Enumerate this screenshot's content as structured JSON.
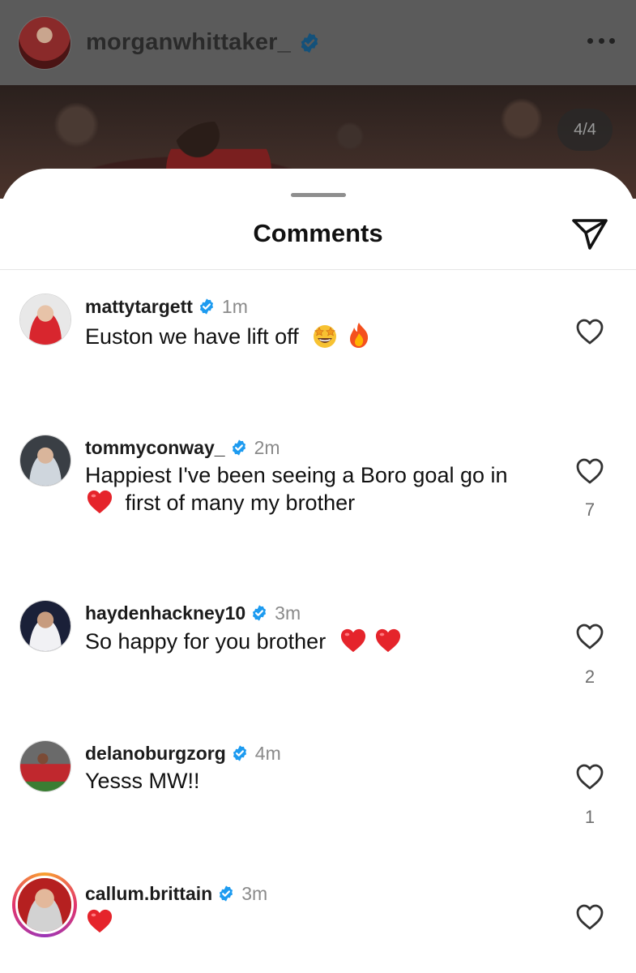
{
  "post": {
    "username": "morganwhittaker_",
    "counter": "4/4"
  },
  "sheet": {
    "title": "Comments"
  },
  "comments": [
    {
      "username": "mattytargett",
      "time": "1m",
      "text": "Euston we have lift off",
      "text_emojis": [
        "star-struck",
        "fire"
      ],
      "likes": ""
    },
    {
      "username": "tommyconway_",
      "time": "2m",
      "text_line1": "Happiest I've been seeing a Boro goal go in",
      "text_line2": "first of many my brother",
      "text_emojis": [
        "red-heart"
      ],
      "likes": "7"
    },
    {
      "username": "haydenhackney10",
      "time": "3m",
      "text": "So happy for you brother",
      "text_emojis": [
        "red-heart",
        "red-heart"
      ],
      "likes": "2"
    },
    {
      "username": "delanoburgzorg",
      "time": "4m",
      "text": "Yesss MW!!",
      "likes": "1"
    },
    {
      "username": "callum.brittain",
      "time": "3m",
      "text": "",
      "text_emojis": [
        "red-heart"
      ],
      "likes": ""
    }
  ],
  "colors": {
    "verified_blue": "#1d9bf0",
    "heart_red": "#e5242b",
    "muted_text": "#8a8a8a"
  },
  "icons": [
    "verified-badge-icon",
    "more-options-icon",
    "send-icon",
    "heart-outline-icon"
  ]
}
